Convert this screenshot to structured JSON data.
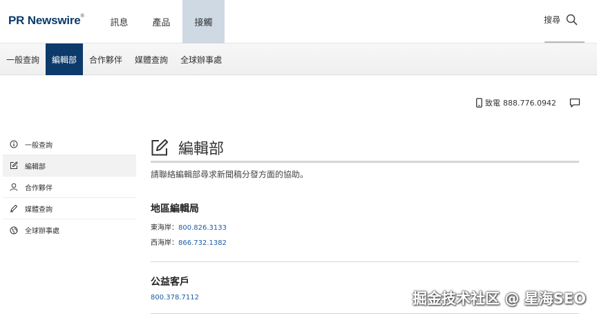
{
  "brand": {
    "logo_text": "PR Newswire"
  },
  "top_nav": [
    {
      "label": "訊息"
    },
    {
      "label": "產品"
    },
    {
      "label": "接觸"
    }
  ],
  "search": {
    "label": "搜尋"
  },
  "sub_nav": [
    {
      "label": "一般查詢"
    },
    {
      "label": "編輯部"
    },
    {
      "label": "合作夥伴"
    },
    {
      "label": "媒體查詢"
    },
    {
      "label": "全球辦事處"
    }
  ],
  "contact": {
    "phone_label": "致電",
    "phone_number": "888.776.0942"
  },
  "sidebar": {
    "items": [
      {
        "label": "一般查詢",
        "icon": "info-icon"
      },
      {
        "label": "編輯部",
        "icon": "edit-icon"
      },
      {
        "label": "合作夥伴",
        "icon": "user-icon"
      },
      {
        "label": "媒體查詢",
        "icon": "pen-icon"
      },
      {
        "label": "全球辦事處",
        "icon": "globe-icon"
      }
    ]
  },
  "main": {
    "title": "編輯部",
    "intro": "請聯絡編輯部尋求新聞稿分發方面的協助。",
    "sections": [
      {
        "title": "地區編輯局",
        "lines": [
          {
            "label": "東海岸：",
            "number": "800.826.3133"
          },
          {
            "label": "西海岸：",
            "number": "866.732.1382"
          }
        ]
      },
      {
        "title": "公益客戶",
        "lines": [
          {
            "label": "",
            "number": "800.378.7112"
          }
        ]
      }
    ]
  },
  "watermark": "掘金技术社区 @ 星海SEO",
  "colors": {
    "brand_navy": "#0c3a6b",
    "active_tab_bg": "#cfd9e4",
    "link_blue": "#1a5aa0"
  }
}
